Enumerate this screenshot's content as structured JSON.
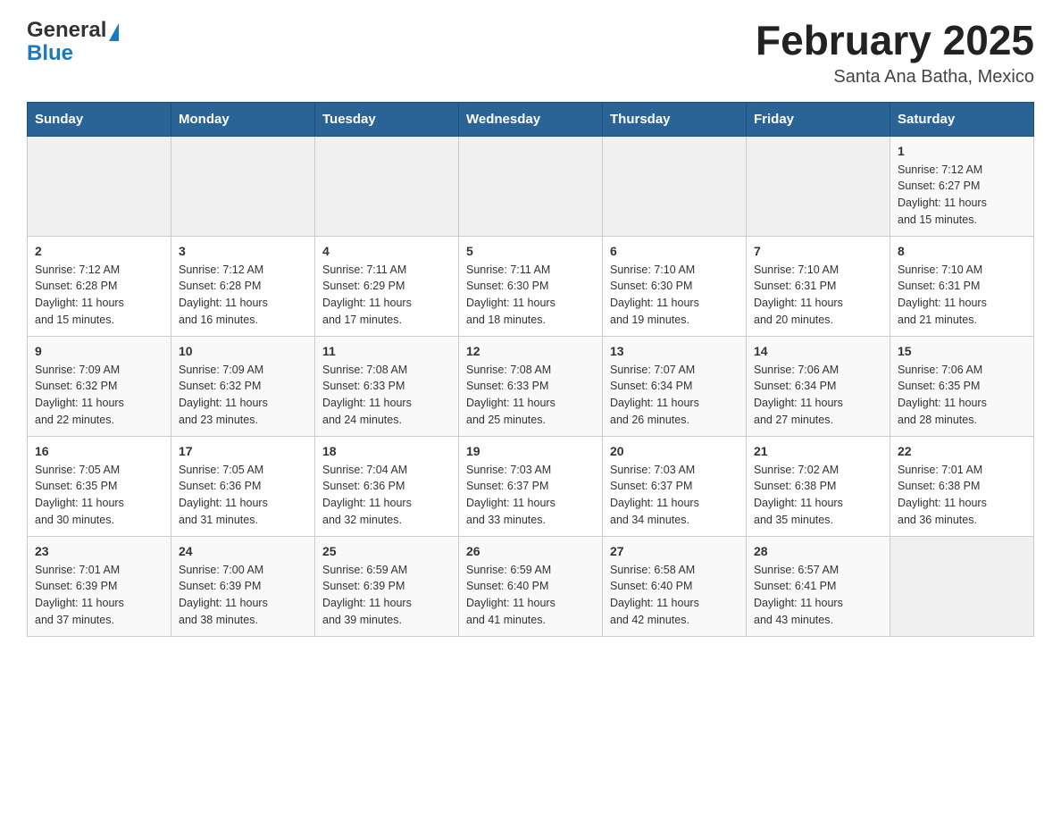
{
  "header": {
    "logo_general": "General",
    "logo_blue": "Blue",
    "month_title": "February 2025",
    "location": "Santa Ana Batha, Mexico"
  },
  "days_of_week": [
    "Sunday",
    "Monday",
    "Tuesday",
    "Wednesday",
    "Thursday",
    "Friday",
    "Saturday"
  ],
  "weeks": [
    [
      {
        "day": "",
        "info": ""
      },
      {
        "day": "",
        "info": ""
      },
      {
        "day": "",
        "info": ""
      },
      {
        "day": "",
        "info": ""
      },
      {
        "day": "",
        "info": ""
      },
      {
        "day": "",
        "info": ""
      },
      {
        "day": "1",
        "info": "Sunrise: 7:12 AM\nSunset: 6:27 PM\nDaylight: 11 hours\nand 15 minutes."
      }
    ],
    [
      {
        "day": "2",
        "info": "Sunrise: 7:12 AM\nSunset: 6:28 PM\nDaylight: 11 hours\nand 15 minutes."
      },
      {
        "day": "3",
        "info": "Sunrise: 7:12 AM\nSunset: 6:28 PM\nDaylight: 11 hours\nand 16 minutes."
      },
      {
        "day": "4",
        "info": "Sunrise: 7:11 AM\nSunset: 6:29 PM\nDaylight: 11 hours\nand 17 minutes."
      },
      {
        "day": "5",
        "info": "Sunrise: 7:11 AM\nSunset: 6:30 PM\nDaylight: 11 hours\nand 18 minutes."
      },
      {
        "day": "6",
        "info": "Sunrise: 7:10 AM\nSunset: 6:30 PM\nDaylight: 11 hours\nand 19 minutes."
      },
      {
        "day": "7",
        "info": "Sunrise: 7:10 AM\nSunset: 6:31 PM\nDaylight: 11 hours\nand 20 minutes."
      },
      {
        "day": "8",
        "info": "Sunrise: 7:10 AM\nSunset: 6:31 PM\nDaylight: 11 hours\nand 21 minutes."
      }
    ],
    [
      {
        "day": "9",
        "info": "Sunrise: 7:09 AM\nSunset: 6:32 PM\nDaylight: 11 hours\nand 22 minutes."
      },
      {
        "day": "10",
        "info": "Sunrise: 7:09 AM\nSunset: 6:32 PM\nDaylight: 11 hours\nand 23 minutes."
      },
      {
        "day": "11",
        "info": "Sunrise: 7:08 AM\nSunset: 6:33 PM\nDaylight: 11 hours\nand 24 minutes."
      },
      {
        "day": "12",
        "info": "Sunrise: 7:08 AM\nSunset: 6:33 PM\nDaylight: 11 hours\nand 25 minutes."
      },
      {
        "day": "13",
        "info": "Sunrise: 7:07 AM\nSunset: 6:34 PM\nDaylight: 11 hours\nand 26 minutes."
      },
      {
        "day": "14",
        "info": "Sunrise: 7:06 AM\nSunset: 6:34 PM\nDaylight: 11 hours\nand 27 minutes."
      },
      {
        "day": "15",
        "info": "Sunrise: 7:06 AM\nSunset: 6:35 PM\nDaylight: 11 hours\nand 28 minutes."
      }
    ],
    [
      {
        "day": "16",
        "info": "Sunrise: 7:05 AM\nSunset: 6:35 PM\nDaylight: 11 hours\nand 30 minutes."
      },
      {
        "day": "17",
        "info": "Sunrise: 7:05 AM\nSunset: 6:36 PM\nDaylight: 11 hours\nand 31 minutes."
      },
      {
        "day": "18",
        "info": "Sunrise: 7:04 AM\nSunset: 6:36 PM\nDaylight: 11 hours\nand 32 minutes."
      },
      {
        "day": "19",
        "info": "Sunrise: 7:03 AM\nSunset: 6:37 PM\nDaylight: 11 hours\nand 33 minutes."
      },
      {
        "day": "20",
        "info": "Sunrise: 7:03 AM\nSunset: 6:37 PM\nDaylight: 11 hours\nand 34 minutes."
      },
      {
        "day": "21",
        "info": "Sunrise: 7:02 AM\nSunset: 6:38 PM\nDaylight: 11 hours\nand 35 minutes."
      },
      {
        "day": "22",
        "info": "Sunrise: 7:01 AM\nSunset: 6:38 PM\nDaylight: 11 hours\nand 36 minutes."
      }
    ],
    [
      {
        "day": "23",
        "info": "Sunrise: 7:01 AM\nSunset: 6:39 PM\nDaylight: 11 hours\nand 37 minutes."
      },
      {
        "day": "24",
        "info": "Sunrise: 7:00 AM\nSunset: 6:39 PM\nDaylight: 11 hours\nand 38 minutes."
      },
      {
        "day": "25",
        "info": "Sunrise: 6:59 AM\nSunset: 6:39 PM\nDaylight: 11 hours\nand 39 minutes."
      },
      {
        "day": "26",
        "info": "Sunrise: 6:59 AM\nSunset: 6:40 PM\nDaylight: 11 hours\nand 41 minutes."
      },
      {
        "day": "27",
        "info": "Sunrise: 6:58 AM\nSunset: 6:40 PM\nDaylight: 11 hours\nand 42 minutes."
      },
      {
        "day": "28",
        "info": "Sunrise: 6:57 AM\nSunset: 6:41 PM\nDaylight: 11 hours\nand 43 minutes."
      },
      {
        "day": "",
        "info": ""
      }
    ]
  ]
}
